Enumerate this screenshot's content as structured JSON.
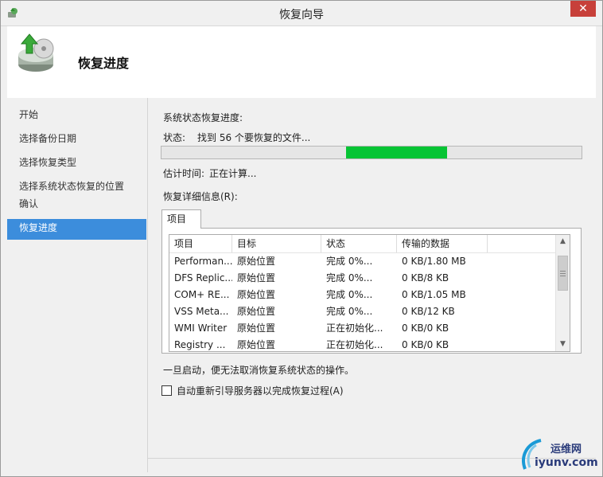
{
  "window": {
    "title": "恢复向导"
  },
  "header": {
    "page_title": "恢复进度"
  },
  "nav": {
    "items": [
      {
        "label": "开始",
        "active": false
      },
      {
        "label": "选择备份日期",
        "active": false
      },
      {
        "label": "选择恢复类型",
        "active": false
      },
      {
        "label": "选择系统状态恢复的位置",
        "active": false
      },
      {
        "label": "确认",
        "active": false
      },
      {
        "label": "恢复进度",
        "active": true
      }
    ]
  },
  "progress_section": {
    "heading": "系统状态恢复进度:",
    "status_label": "状态:",
    "status_value": "找到 56 个要恢复的文件...",
    "bar_fill_start_fraction": 0.44,
    "bar_fill_end_fraction": 0.68,
    "estimate_label": "估计时间:",
    "estimate_value": "正在计算...",
    "details_label": "恢复详细信息(R):"
  },
  "tab": {
    "label": "项目"
  },
  "table": {
    "columns": [
      "项目",
      "目标",
      "状态",
      "传输的数据"
    ],
    "rows": [
      [
        "Performan...",
        "原始位置",
        "完成 0%...",
        "0 KB/1.80 MB"
      ],
      [
        "DFS Replic...",
        "原始位置",
        "完成 0%...",
        "0 KB/8 KB"
      ],
      [
        "COM+ RE...",
        "原始位置",
        "完成 0%...",
        "0 KB/1.05 MB"
      ],
      [
        "VSS Meta...",
        "原始位置",
        "完成 0%...",
        "0 KB/12 KB"
      ],
      [
        "WMI Writer",
        "原始位置",
        "正在初始化...",
        "0 KB/0 KB"
      ],
      [
        "Registry ...",
        "原始位置",
        "正在初始化...",
        "0 KB/0 KB"
      ]
    ]
  },
  "notice": "一旦启动，便无法取消恢复系统状态的操作。",
  "restart_checkbox": {
    "label": "自动重新引导服务器以完成恢复过程(A)",
    "checked": false
  },
  "watermark": {
    "line1": "运维网",
    "line2": "iyunv.com"
  },
  "colors": {
    "accent_nav": "#3c8ddc",
    "progress_fill": "#06c434",
    "close_button": "#c7403a"
  }
}
